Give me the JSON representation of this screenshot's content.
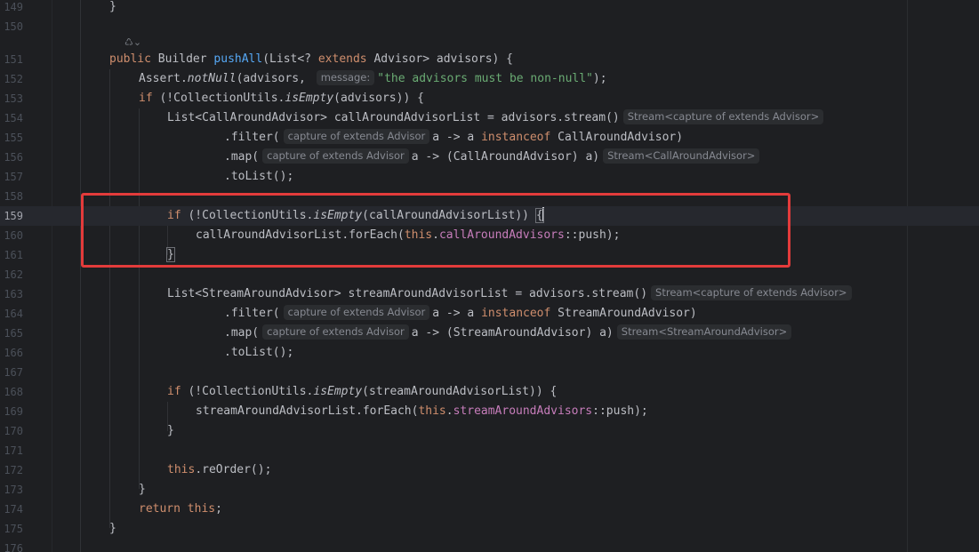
{
  "annotation": {
    "color": "#e33b3b"
  },
  "inline_icon": {
    "symbol": "♺⌄",
    "name": "ai-assistant-icon"
  },
  "lines": {
    "l149": {
      "num": "149",
      "t1": "}"
    },
    "l150": {
      "num": "150"
    },
    "l151": {
      "num": "151",
      "t1": "public",
      "t2": " Builder ",
      "t3": "pushAll",
      "t4": "(List<? ",
      "t5": "extends",
      "t6": " Advisor> advisors) {"
    },
    "l152": {
      "num": "152",
      "t1": "Assert.",
      "t2": "notNull",
      "t3": "(advisors, ",
      "hint1": "message:",
      "t4": "\"the advisors must be non-null\"",
      "t5": ");"
    },
    "l153": {
      "num": "153",
      "t1": "if",
      "t2": " (!CollectionUtils.",
      "t3": "isEmpty",
      "t4": "(advisors)) {"
    },
    "l154": {
      "num": "154",
      "t1": "List<CallAroundAdvisor> callAroundAdvisorList = advisors.stream()",
      "hint1": "Stream<capture of extends Advisor>"
    },
    "l155": {
      "num": "155",
      "t1": ".filter(",
      "hint1": "capture of extends Advisor",
      "t2": "a -> a ",
      "t3": "instanceof",
      "t4": " CallAroundAdvisor)"
    },
    "l156": {
      "num": "156",
      "t1": ".map(",
      "hint1": "capture of extends Advisor",
      "t2": "a -> (CallAroundAdvisor) a)",
      "hint2": "Stream<CallAroundAdvisor>"
    },
    "l157": {
      "num": "157",
      "t1": ".toList();"
    },
    "l158": {
      "num": "158"
    },
    "l159": {
      "num": "159",
      "t1": "if",
      "t2": " (!CollectionUtils.",
      "t3": "isEmpty",
      "t4": "(callAroundAdvisorList)) ",
      "t5": "{"
    },
    "l160": {
      "num": "160",
      "t1": "callAroundAdvisorList.forEach(",
      "t2": "this",
      "t3": ".",
      "t4": "callAroundAdvisors",
      "t5": "::push);"
    },
    "l161": {
      "num": "161",
      "t1": "}"
    },
    "l162": {
      "num": "162"
    },
    "l163": {
      "num": "163",
      "t1": "List<StreamAroundAdvisor> streamAroundAdvisorList = advisors.stream()",
      "hint1": "Stream<capture of extends Advisor>"
    },
    "l164": {
      "num": "164",
      "t1": ".filter(",
      "hint1": "capture of extends Advisor",
      "t2": "a -> a ",
      "t3": "instanceof",
      "t4": " StreamAroundAdvisor)"
    },
    "l165": {
      "num": "165",
      "t1": ".map(",
      "hint1": "capture of extends Advisor",
      "t2": "a -> (StreamAroundAdvisor) a)",
      "hint2": "Stream<StreamAroundAdvisor>"
    },
    "l166": {
      "num": "166",
      "t1": ".toList();"
    },
    "l167": {
      "num": "167"
    },
    "l168": {
      "num": "168",
      "t1": "if",
      "t2": " (!CollectionUtils.",
      "t3": "isEmpty",
      "t4": "(streamAroundAdvisorList)) {"
    },
    "l169": {
      "num": "169",
      "t1": "streamAroundAdvisorList.forEach(",
      "t2": "this",
      "t3": ".",
      "t4": "streamAroundAdvisors",
      "t5": "::push);"
    },
    "l170": {
      "num": "170",
      "t1": "}"
    },
    "l171": {
      "num": "171"
    },
    "l172": {
      "num": "172",
      "t1": "this",
      "t2": ".reOrder();"
    },
    "l173": {
      "num": "173",
      "t1": "}"
    },
    "l174": {
      "num": "174",
      "t1": "return",
      "t2": " ",
      "t3": "this",
      "t4": ";"
    },
    "l175": {
      "num": "175",
      "t1": "}"
    },
    "l176": {
      "num": "176"
    }
  }
}
